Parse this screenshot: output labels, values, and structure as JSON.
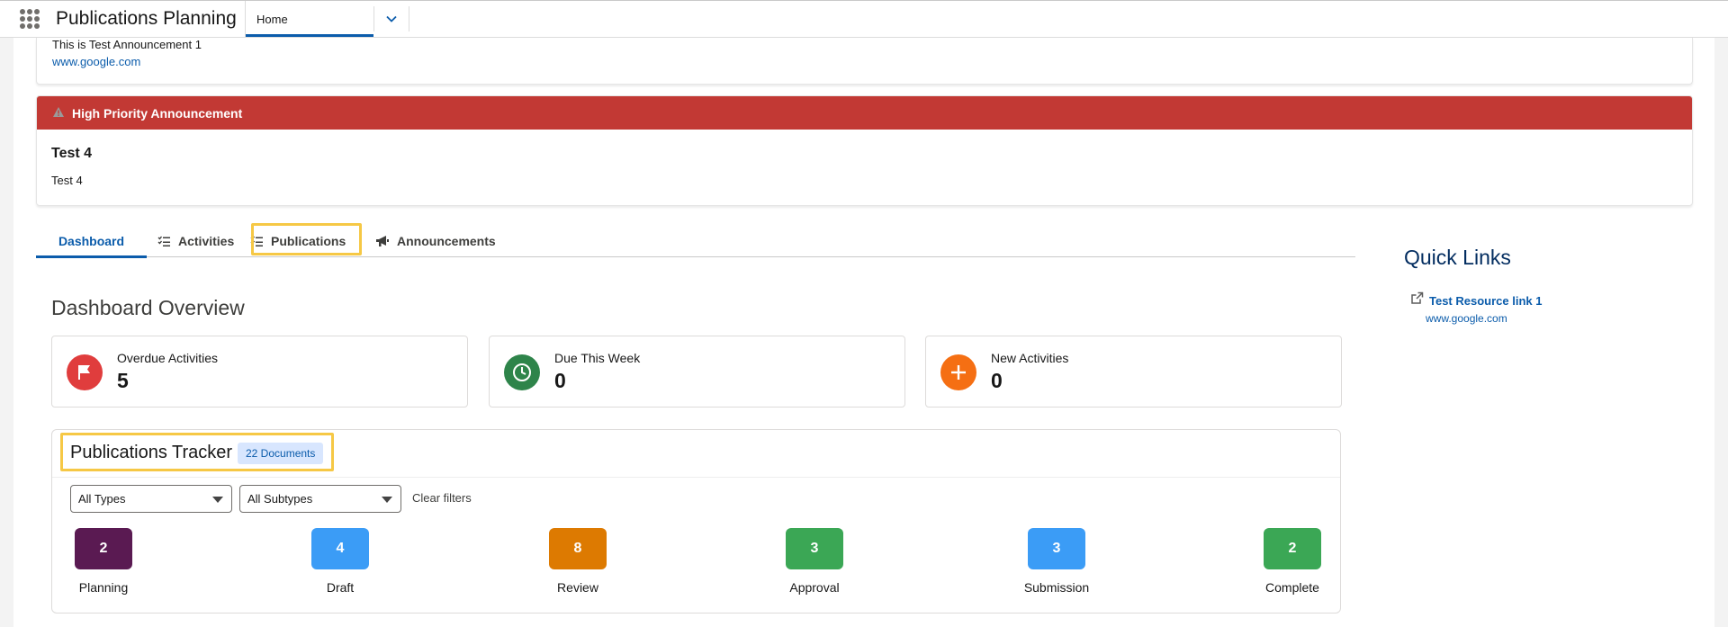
{
  "app": {
    "title": "Publications Planning",
    "nav_tab": "Home"
  },
  "announcement": {
    "text": "This is Test Announcement 1",
    "link": "www.google.com"
  },
  "high_priority": {
    "header": "High Priority Announcement",
    "title": "Test 4",
    "body": "Test 4",
    "color": "#c23934"
  },
  "tabs": [
    {
      "label": "Dashboard",
      "icon": "none",
      "active": true
    },
    {
      "label": "Activities",
      "icon": "checklist-icon"
    },
    {
      "label": "Publications",
      "icon": "checklist-icon",
      "highlighted": true
    },
    {
      "label": "Announcements",
      "icon": "megaphone-icon"
    }
  ],
  "overview": {
    "title": "Dashboard Overview",
    "stats": [
      {
        "label": "Overdue Activities",
        "value": "5",
        "icon": "flag-icon",
        "color": "#e03d3d"
      },
      {
        "label": "Due This Week",
        "value": "0",
        "icon": "clock-icon",
        "color": "#2e844a"
      },
      {
        "label": "New Activities",
        "value": "0",
        "icon": "plus-icon",
        "color": "#f56f13"
      }
    ]
  },
  "tracker": {
    "title": "Publications Tracker",
    "badge": "22 Documents",
    "filters": {
      "type": "All Types",
      "subtype": "All Subtypes",
      "clear": "Clear filters"
    },
    "stages": [
      {
        "label": "Planning",
        "count": "2",
        "color": "#5a1a52"
      },
      {
        "label": "Draft",
        "count": "4",
        "color": "#3b9cf6"
      },
      {
        "label": "Review",
        "count": "8",
        "color": "#dd7a01"
      },
      {
        "label": "Approval",
        "count": "3",
        "color": "#3ba755"
      },
      {
        "label": "Submission",
        "count": "3",
        "color": "#3b9cf6"
      },
      {
        "label": "Complete",
        "count": "2",
        "color": "#3ba755"
      }
    ]
  },
  "quick_links": {
    "title": "Quick Links",
    "items": [
      {
        "label": "Test Resource link 1",
        "url": "www.google.com",
        "icon": "external-link-icon"
      }
    ]
  },
  "highlight_color": "#f6c845"
}
